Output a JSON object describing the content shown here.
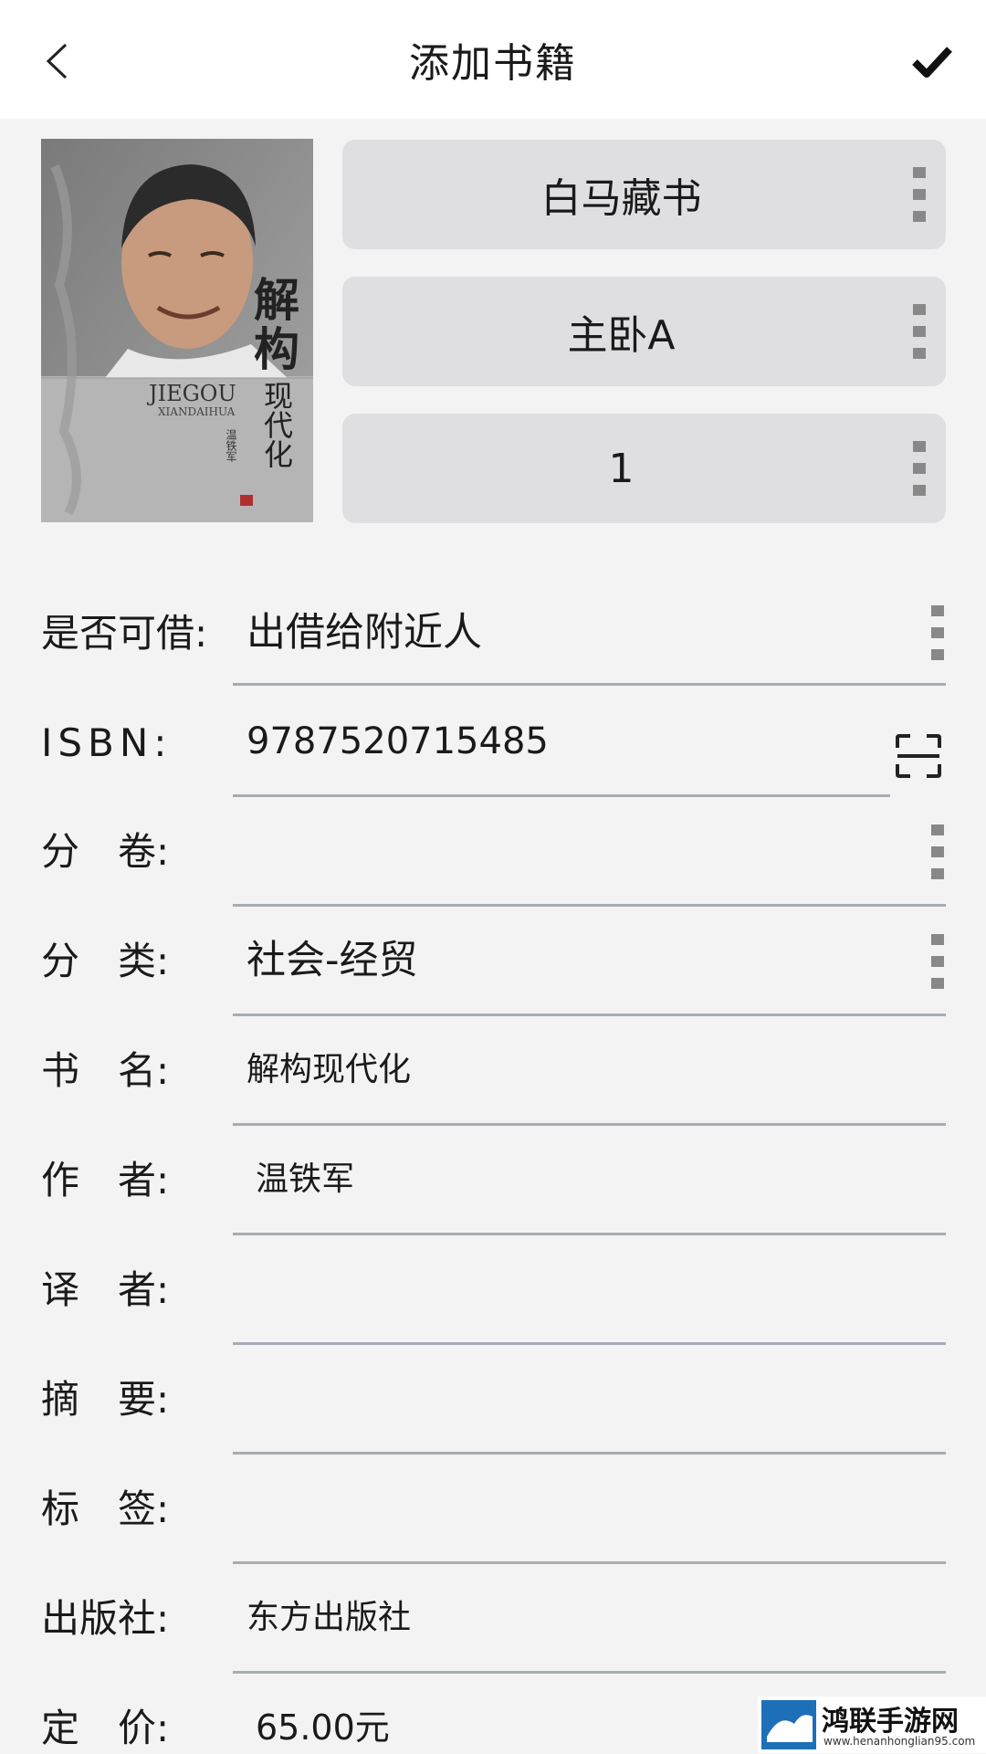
{
  "header": {
    "title": "添加书籍",
    "back_icon": "chevron-left-icon",
    "confirm_icon": "check-icon"
  },
  "cover": {
    "title_chars": [
      "解",
      "构"
    ],
    "subtitle": "现代化",
    "pinyin_line1": "JIEGOU",
    "pinyin_line2": "XIANDAIHUA",
    "author": "温铁军"
  },
  "selectors": [
    {
      "value": "白马藏书",
      "icon": "more-vert-icon"
    },
    {
      "value": "主卧A",
      "icon": "more-vert-icon"
    },
    {
      "value": "1",
      "icon": "more-vert-icon"
    }
  ],
  "fields": {
    "loanable": {
      "label": "是否可借:",
      "value": "出借给附近人"
    },
    "isbn": {
      "label": "ISBN:",
      "value": "9787520715485",
      "icon": "scan-icon"
    },
    "volume": {
      "label": "分　卷:",
      "value": ""
    },
    "category": {
      "label": "分　类:",
      "value": "社会-经贸"
    },
    "book_title": {
      "label": "书　名:",
      "value": "解构现代化"
    },
    "author": {
      "label": "作　者:",
      "value": "温铁军"
    },
    "translator": {
      "label": "译　者:",
      "value": ""
    },
    "summary": {
      "label": "摘　要:",
      "value": ""
    },
    "tags": {
      "label": "标　签:",
      "value": ""
    },
    "publisher": {
      "label": "出版社:",
      "value": "东方出版社"
    },
    "price": {
      "label": "定　价:",
      "value": "65.00元"
    }
  },
  "watermark": {
    "name": "鸿联手游网",
    "url": "www.henanhonglian95.com"
  },
  "colors": {
    "background": "#f3f3f3",
    "selector_bg": "#dfdfe1",
    "underline": "#a7acb3",
    "dots": "#888888"
  }
}
